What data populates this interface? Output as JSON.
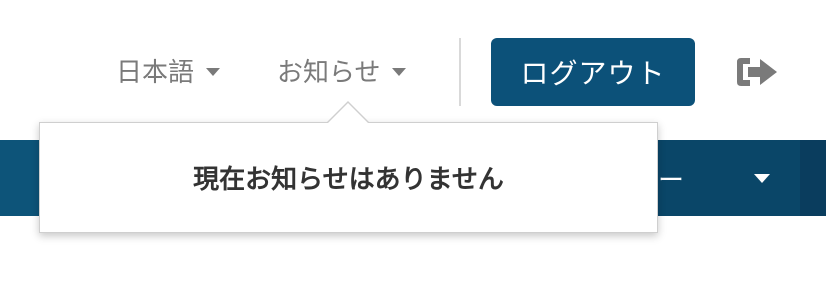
{
  "header": {
    "language_label": "日本語",
    "notifications_label": "お知らせ",
    "logout_label": "ログアウト"
  },
  "menubar": {
    "menu_label": "ニュー"
  },
  "notifications_popover": {
    "message": "現在お知らせはありません"
  },
  "icons": {
    "logout": "sign-out-icon",
    "caret": "chevron-down-icon"
  },
  "colors": {
    "primary": "#0c5179",
    "menubar": "#0d5479",
    "menubar_dark": "#0a3d5e",
    "nav_text": "#7a7a7a",
    "popover_text": "#333333"
  }
}
